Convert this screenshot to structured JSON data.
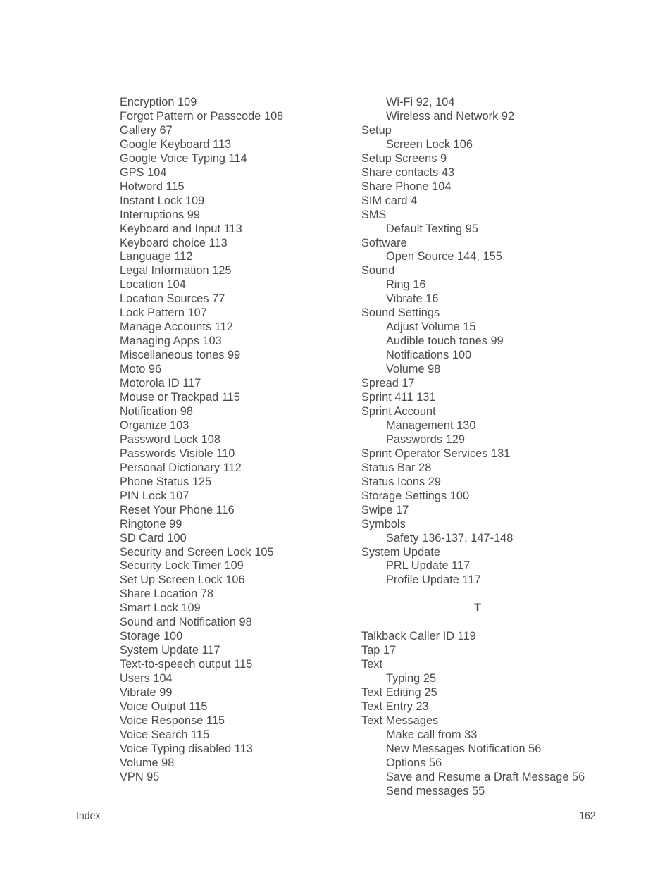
{
  "document": {
    "type": "index-page",
    "footer": {
      "label": "Index",
      "page_number": "162"
    },
    "text_color": "#4a4a48"
  },
  "left_column": {
    "entries": [
      {
        "text": "Encryption  109",
        "level": 0
      },
      {
        "text": "Forgot Pattern or Passcode  108",
        "level": 0
      },
      {
        "text": "Gallery  67",
        "level": 0
      },
      {
        "text": "Google Keyboard  113",
        "level": 0
      },
      {
        "text": "Google Voice Typing  114",
        "level": 0
      },
      {
        "text": "GPS  104",
        "level": 0
      },
      {
        "text": "Hotword  115",
        "level": 0
      },
      {
        "text": "Instant Lock  109",
        "level": 0
      },
      {
        "text": "Interruptions  99",
        "level": 0
      },
      {
        "text": "Keyboard and Input  113",
        "level": 0
      },
      {
        "text": "Keyboard choice  113",
        "level": 0
      },
      {
        "text": "Language  112",
        "level": 0
      },
      {
        "text": "Legal Information  125",
        "level": 0
      },
      {
        "text": "Location  104",
        "level": 0
      },
      {
        "text": "Location Sources  77",
        "level": 0
      },
      {
        "text": "Lock Pattern  107",
        "level": 0
      },
      {
        "text": "Manage Accounts  112",
        "level": 0
      },
      {
        "text": "Managing Apps  103",
        "level": 0
      },
      {
        "text": "Miscellaneous tones  99",
        "level": 0
      },
      {
        "text": "Moto  96",
        "level": 0
      },
      {
        "text": "Motorola ID  117",
        "level": 0
      },
      {
        "text": "Mouse or Trackpad  115",
        "level": 0
      },
      {
        "text": "Notification  98",
        "level": 0
      },
      {
        "text": "Organize  103",
        "level": 0
      },
      {
        "text": "Password Lock  108",
        "level": 0
      },
      {
        "text": "Passwords Visible  110",
        "level": 0
      },
      {
        "text": "Personal Dictionary  112",
        "level": 0
      },
      {
        "text": "Phone Status  125",
        "level": 0
      },
      {
        "text": "PIN Lock  107",
        "level": 0
      },
      {
        "text": "Reset Your Phone  116",
        "level": 0
      },
      {
        "text": "Ringtone  99",
        "level": 0
      },
      {
        "text": "SD Card  100",
        "level": 0
      },
      {
        "text": "Security and Screen Lock  105",
        "level": 0
      },
      {
        "text": "Security Lock Timer  109",
        "level": 0
      },
      {
        "text": "Set Up Screen Lock  106",
        "level": 0
      },
      {
        "text": "Share Location  78",
        "level": 0
      },
      {
        "text": "Smart Lock  109",
        "level": 0
      },
      {
        "text": "Sound and Notification  98",
        "level": 0
      },
      {
        "text": "Storage  100",
        "level": 0
      },
      {
        "text": "System Update  117",
        "level": 0
      },
      {
        "text": "Text-to-speech output  115",
        "level": 0
      },
      {
        "text": "Users  104",
        "level": 0
      },
      {
        "text": "Vibrate  99",
        "level": 0
      },
      {
        "text": "Voice Output  115",
        "level": 0
      },
      {
        "text": "Voice Response  115",
        "level": 0
      },
      {
        "text": "Voice Search  115",
        "level": 0
      },
      {
        "text": "Voice Typing disabled  113",
        "level": 0
      },
      {
        "text": "Volume  98",
        "level": 0
      },
      {
        "text": "VPN  95",
        "level": 0
      }
    ]
  },
  "right_column": {
    "entries": [
      {
        "text": "Wi-Fi  92, 104",
        "level": 1
      },
      {
        "text": "Wireless and Network  92",
        "level": 1
      },
      {
        "text": "Setup",
        "level": 0
      },
      {
        "text": "Screen Lock  106",
        "level": 1
      },
      {
        "text": "Setup Screens  9",
        "level": 0
      },
      {
        "text": "Share contacts  43",
        "level": 0
      },
      {
        "text": "Share Phone  104",
        "level": 0
      },
      {
        "text": "SIM card  4",
        "level": 0
      },
      {
        "text": "SMS",
        "level": 0
      },
      {
        "text": "Default Texting  95",
        "level": 1
      },
      {
        "text": "Software",
        "level": 0
      },
      {
        "text": "Open Source  144, 155",
        "level": 1
      },
      {
        "text": "Sound",
        "level": 0
      },
      {
        "text": "Ring  16",
        "level": 1
      },
      {
        "text": "Vibrate  16",
        "level": 1
      },
      {
        "text": "Sound Settings",
        "level": 0
      },
      {
        "text": "Adjust Volume  15",
        "level": 1
      },
      {
        "text": "Audible touch tones  99",
        "level": 1
      },
      {
        "text": "Notifications  100",
        "level": 1
      },
      {
        "text": "Volume  98",
        "level": 1
      },
      {
        "text": "Spread  17",
        "level": 0
      },
      {
        "text": "Sprint 411  131",
        "level": 0
      },
      {
        "text": "Sprint Account",
        "level": 0
      },
      {
        "text": "Management  130",
        "level": 1
      },
      {
        "text": "Passwords  129",
        "level": 1
      },
      {
        "text": "Sprint Operator Services  131",
        "level": 0
      },
      {
        "text": "Status Bar  28",
        "level": 0
      },
      {
        "text": "Status Icons  29",
        "level": 0
      },
      {
        "text": "Storage Settings  100",
        "level": 0
      },
      {
        "text": "Swipe  17",
        "level": 0
      },
      {
        "text": "Symbols",
        "level": 0
      },
      {
        "text": "Safety  136-137, 147-148",
        "level": 1
      },
      {
        "text": "System Update",
        "level": 0
      },
      {
        "text": "PRL Update  117",
        "level": 1
      },
      {
        "text": "Profile Update  117",
        "level": 1
      },
      {
        "type": "spacer"
      },
      {
        "type": "letter",
        "text": "T"
      },
      {
        "type": "spacer"
      },
      {
        "text": "Talkback Caller ID  119",
        "level": 0
      },
      {
        "text": "Tap  17",
        "level": 0
      },
      {
        "text": "Text",
        "level": 0
      },
      {
        "text": "Typing  25",
        "level": 1
      },
      {
        "text": "Text Editing  25",
        "level": 0
      },
      {
        "text": "Text Entry  23",
        "level": 0
      },
      {
        "text": "Text Messages",
        "level": 0
      },
      {
        "text": "Make call from  33",
        "level": 1
      },
      {
        "text": "New Messages Notification  56",
        "level": 1
      },
      {
        "text": "Options  56",
        "level": 1
      },
      {
        "text": "Save and Resume a Draft Message  56",
        "level": 1
      },
      {
        "text": "Send messages  55",
        "level": 1
      }
    ]
  }
}
